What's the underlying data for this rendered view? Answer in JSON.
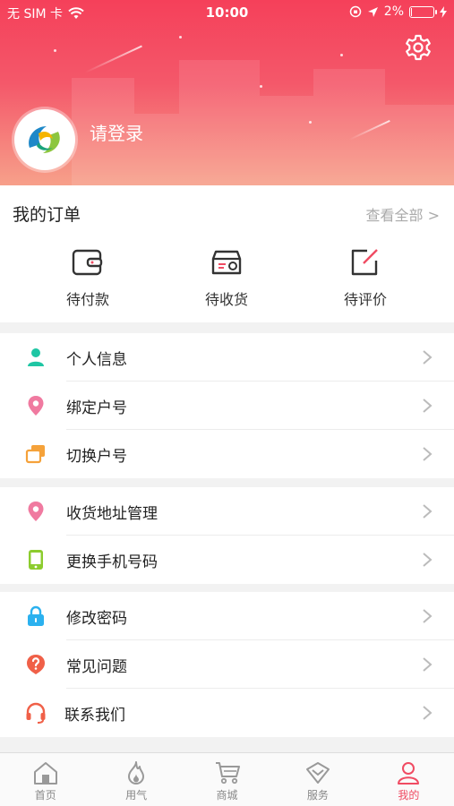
{
  "status_bar": {
    "carrier": "无 SIM 卡",
    "time": "10:00",
    "battery_percent": "2%",
    "battery_level": 0.02
  },
  "header": {
    "login_text": "请登录",
    "settings_icon": "gear-icon",
    "avatar_logo": "company-logo"
  },
  "orders": {
    "title": "我的订单",
    "view_all": "查看全部 >",
    "items": [
      {
        "label": "待付款",
        "icon": "wallet-icon"
      },
      {
        "label": "待收货",
        "icon": "delivery-box-icon"
      },
      {
        "label": "待评价",
        "icon": "edit-icon"
      }
    ]
  },
  "menu": {
    "group1": [
      {
        "label": "个人信息",
        "icon": "person-icon",
        "color": "#1fc6a4"
      },
      {
        "label": "绑定户号",
        "icon": "location-pin-icon",
        "color": "#f07aa0"
      },
      {
        "label": "切换户号",
        "icon": "switch-cards-icon",
        "color": "#f5a23a"
      }
    ],
    "group2": [
      {
        "label": "收货地址管理",
        "icon": "location-pin-icon",
        "color": "#f07aa0"
      },
      {
        "label": "更换手机号码",
        "icon": "phone-icon",
        "color": "#8ccc2e"
      }
    ],
    "group3": [
      {
        "label": "修改密码",
        "icon": "lock-icon",
        "color": "#2bb1ef"
      },
      {
        "label": "常见问题",
        "icon": "question-icon",
        "color": "#f06048"
      },
      {
        "label": "联系我们",
        "icon": "headset-icon",
        "color": "#f06048"
      }
    ]
  },
  "tabbar": {
    "tabs": [
      {
        "label": "首页",
        "icon": "home-icon",
        "active": false
      },
      {
        "label": "用气",
        "icon": "flame-icon",
        "active": false
      },
      {
        "label": "商城",
        "icon": "cart-icon",
        "active": false
      },
      {
        "label": "服务",
        "icon": "diamond-icon",
        "active": false
      },
      {
        "label": "我的",
        "icon": "user-icon",
        "active": true
      }
    ],
    "active_color": "#f04b62",
    "inactive_color": "#888888"
  }
}
